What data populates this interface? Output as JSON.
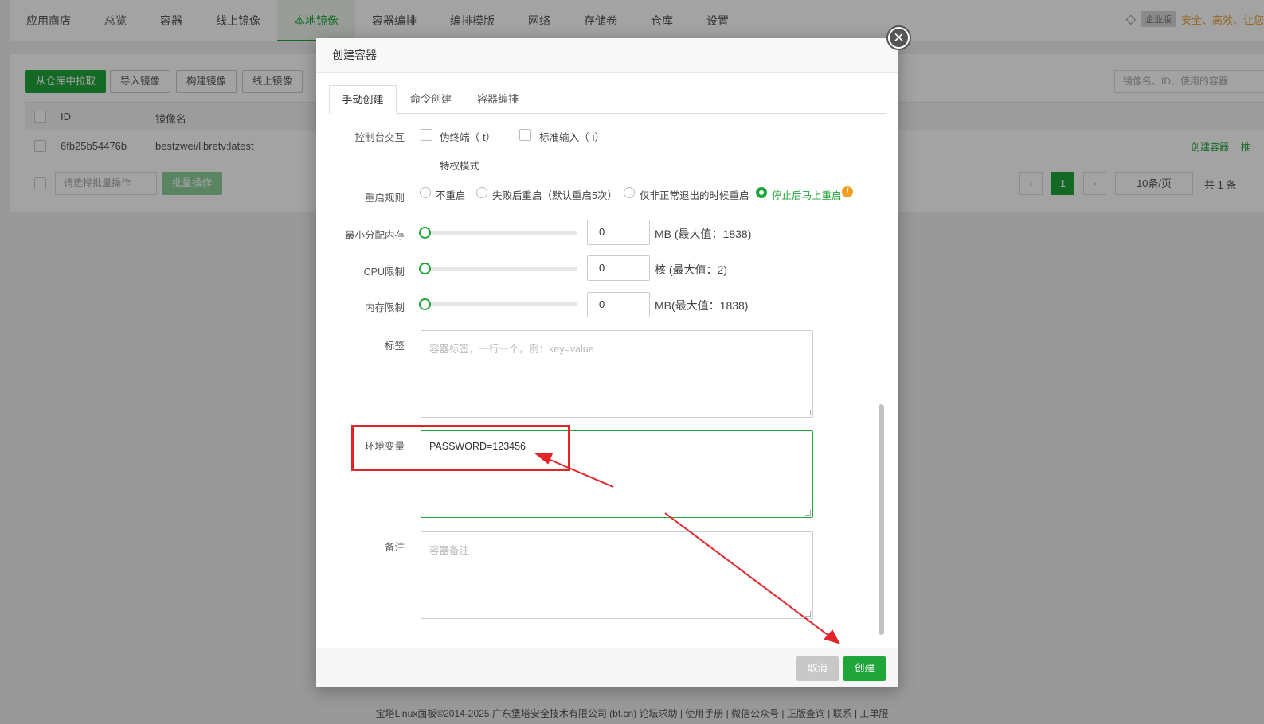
{
  "topnav": {
    "tabs": [
      "应用商店",
      "总览",
      "容器",
      "线上镜像",
      "本地镜像",
      "容器编排",
      "编排模版",
      "网络",
      "存储卷",
      "仓库",
      "设置"
    ],
    "active_index": 4,
    "enterprise_badge": "企业版",
    "promo": "安全、高效、让您"
  },
  "toolbar": {
    "pull": "从仓库中拉取",
    "import": "导入镜像",
    "build": "构建镜像",
    "online": "线上镜像",
    "search_placeholder": "镜像名、ID、使用的容器"
  },
  "table": {
    "headers": [
      "ID",
      "镜像名"
    ],
    "rows": [
      {
        "id": "6fb25b54476b",
        "name": "bestzwei/libretv:latest",
        "action": "创建容器",
        "action2": "推"
      }
    ]
  },
  "batch": {
    "placeholder": "请选择批量操作",
    "button": "批量操作"
  },
  "pager": {
    "prev": "‹",
    "next": "›",
    "current": "1",
    "page_size": "10条/页",
    "total": "共 1 条"
  },
  "footer": {
    "text": "宝塔Linux面板©2014-2025 广东堡塔安全技术有限公司 (bt.cn)  论坛求助 | 使用手册 | 微信公众号 | 正版查询 | 联系 | 工单服"
  },
  "modal": {
    "title": "创建容器",
    "close_symbol": "✕",
    "tabs": [
      "手动创建",
      "命令创建",
      "容器编排"
    ],
    "active_tab": 0,
    "console_label": "控制台交互",
    "pseudo_tty": "伪终端（-t）",
    "stdin": "标准输入（-i）",
    "privileged": "特权模式",
    "restart_label": "重启规则",
    "restart_options": [
      "不重启",
      "失败后重启（默认重启5次）",
      "仅非正常退出的时候重启",
      "停止后马上重启"
    ],
    "restart_selected": 3,
    "info_symbol": "i",
    "limits": [
      {
        "label": "最小分配内存",
        "value": "0",
        "unit": "MB (最大值：1838)",
        "level": 0
      },
      {
        "label": "CPU限制",
        "value": "0",
        "unit": "核 (最大值：2)",
        "level": 0
      },
      {
        "label": "内存限制",
        "value": "0",
        "unit": "MB(最大值：1838)",
        "level": 0
      }
    ],
    "tags_label": "标签",
    "tags_placeholder": "容器标签，一行一个，例：key=value",
    "env_label": "环境变量",
    "env_value": "PASSWORD=123456",
    "remark_label": "备注",
    "remark_placeholder": "容器备注",
    "cancel": "取消",
    "create": "创建"
  },
  "colors": {
    "accent": "#20a53a",
    "annotation": "#e5242a"
  }
}
